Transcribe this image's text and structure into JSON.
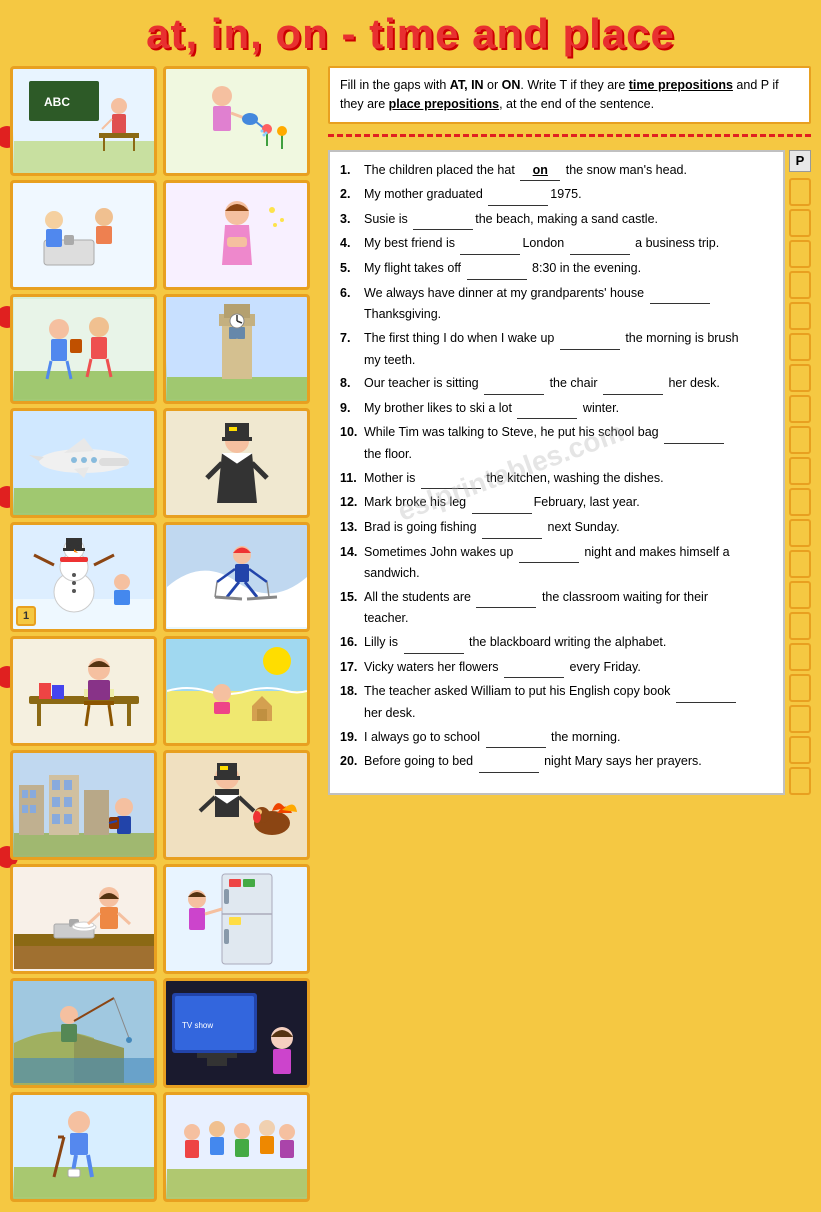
{
  "title": "at, in, on - time and place",
  "instructions": {
    "text": "Fill in the gaps with AT, IN or ON. Write T if they are time prepositions and P if they are place prepositions, at the end of the sentence."
  },
  "p_label": "P",
  "exercises": [
    {
      "num": "1.",
      "text": "The children placed the hat ",
      "blank1": "on",
      "blank1_filled": true,
      "rest": " the snow man's head."
    },
    {
      "num": "2.",
      "text": "My mother graduated ",
      "blank1": "",
      "rest": "1975."
    },
    {
      "num": "3.",
      "text": "Susie is ",
      "blank1": "",
      "rest": "the beach, making a sand castle."
    },
    {
      "num": "4.",
      "text": "My best friend is ",
      "blank1": "",
      "rest": "London ",
      "blank2": "",
      "rest2": "a business trip."
    },
    {
      "num": "5.",
      "text": "My flight takes off ",
      "blank1": "",
      "rest": "8:30 in the evening."
    },
    {
      "num": "6.",
      "text": "We always have dinner at my grandparents' house ",
      "blank1": "",
      "rest": "Thanksgiving."
    },
    {
      "num": "7.",
      "text": "The first thing I do when I wake up ",
      "blank1": "",
      "rest": "the morning is brush my teeth."
    },
    {
      "num": "8.",
      "text": "Our teacher is sitting ",
      "blank1": "",
      "rest": "the chair ",
      "blank2": "",
      "rest2": "her desk."
    },
    {
      "num": "9.",
      "text": "My brother likes to ski a lot ",
      "blank1": "",
      "rest": "winter."
    },
    {
      "num": "10.",
      "text": "While Tim was talking to Steve, he put his school bag ",
      "blank1": "",
      "rest": "the floor."
    },
    {
      "num": "11.",
      "text": "Mother is ",
      "blank1": "",
      "rest": "the kitchen, washing the dishes."
    },
    {
      "num": "12.",
      "text": "Mark broke his leg ",
      "blank1": "",
      "rest": "February, last year."
    },
    {
      "num": "13.",
      "text": "Brad is going fishing ",
      "blank1": "",
      "rest": "next Sunday."
    },
    {
      "num": "14.",
      "text": "Sometimes John wakes up ",
      "blank1": "",
      "rest": "night and makes himself a sandwich."
    },
    {
      "num": "15.",
      "text": "All the students are ",
      "blank1": "",
      "rest": "the classroom waiting for their teacher."
    },
    {
      "num": "16.",
      "text": "Lilly is ",
      "blank1": "",
      "rest": "the blackboard writing the alphabet."
    },
    {
      "num": "17.",
      "text": "Vicky waters her flowers ",
      "blank1": "",
      "rest": "every Friday."
    },
    {
      "num": "18.",
      "text": "The teacher asked William to put his English copy book ",
      "blank1": "",
      "rest": "her desk."
    },
    {
      "num": "19.",
      "text": "I always go to school ",
      "blank1": "",
      "rest": "the morning."
    },
    {
      "num": "20.",
      "text": "Before going to bed ",
      "blank1": "",
      "rest": "night Mary says her prayers."
    }
  ],
  "images": [
    {
      "id": "classroom",
      "scene": "classroom",
      "label": "Classroom with teacher"
    },
    {
      "id": "girl-watering",
      "scene": "girl-watering",
      "label": "Girl watering flowers"
    },
    {
      "id": "kids-sink",
      "scene": "sink",
      "label": "Kids at sink"
    },
    {
      "id": "girl-praying",
      "scene": "girl-praying",
      "label": "Girl praying"
    },
    {
      "id": "kids-walking",
      "scene": "kids-walking",
      "label": "Kids walking"
    },
    {
      "id": "big-ben",
      "scene": "bigben",
      "label": "Big Ben"
    },
    {
      "id": "airplane",
      "scene": "plane",
      "label": "Airplane"
    },
    {
      "id": "pilgrim-girl",
      "scene": "pilgrim",
      "label": "Pilgrim girl"
    },
    {
      "id": "snowman",
      "scene": "snowman",
      "label": "Snowman scene",
      "badge": "1"
    },
    {
      "id": "skiing",
      "scene": "skiing",
      "label": "Skiing"
    },
    {
      "id": "teacher-desk",
      "scene": "teacher",
      "label": "Teacher at desk"
    },
    {
      "id": "beach",
      "scene": "beach",
      "label": "Beach scene"
    },
    {
      "id": "city-scene",
      "scene": "city",
      "label": "City scene"
    },
    {
      "id": "pilgrim2",
      "scene": "pilgrim2",
      "label": "Pilgrim with turkey"
    },
    {
      "id": "kitchen",
      "scene": "kitchen",
      "label": "Kitchen scene"
    },
    {
      "id": "fridge",
      "scene": "fridge",
      "label": "Girl at fridge"
    },
    {
      "id": "cliff-fishing",
      "scene": "cliff",
      "label": "Fishing at cliff"
    },
    {
      "id": "girl-tv",
      "scene": "tv",
      "label": "Girl watching TV"
    },
    {
      "id": "child-outdoor",
      "scene": "child",
      "label": "Child outdoors"
    },
    {
      "id": "group-children",
      "scene": "group",
      "label": "Group of children"
    }
  ],
  "red_dots": [
    0,
    2,
    4,
    6,
    8
  ],
  "watermark": "eslprintables.com"
}
